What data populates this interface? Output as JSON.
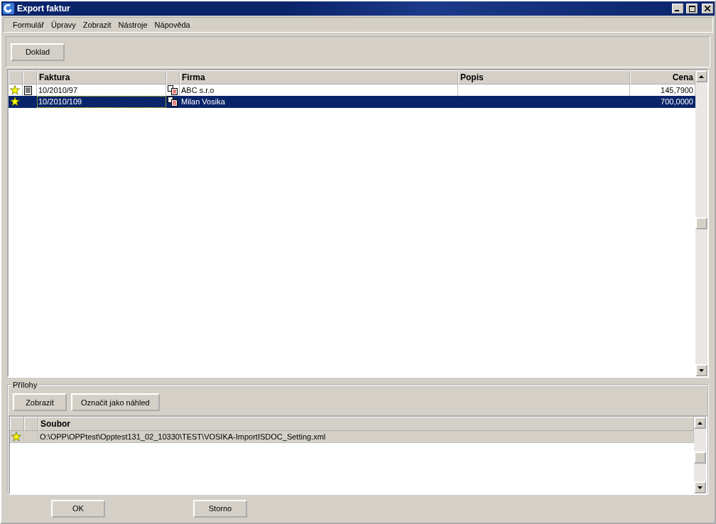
{
  "window": {
    "title": "Export faktur"
  },
  "menu": [
    "Formulář",
    "Úpravy",
    "Zobrazit",
    "Nástroje",
    "Nápověda"
  ],
  "toolbar": {
    "buttons": [
      "Doklad"
    ]
  },
  "invoices": {
    "columns": [
      "Faktura",
      "Firma",
      "Popis",
      "Cena"
    ],
    "rows": [
      {
        "faktura": "10/2010/97",
        "firma": "ABC s.r.o",
        "popis": "",
        "cena": "145,7900",
        "note": true,
        "selected": false
      },
      {
        "faktura": "10/2010/109",
        "firma": "Milan Vosika",
        "popis": "",
        "cena": "700,0000",
        "note": false,
        "selected": true
      }
    ]
  },
  "attachments": {
    "title": "Přílohy",
    "buttons": [
      "Zobrazit",
      "Označit jako náhled"
    ],
    "columns": [
      "Soubor"
    ],
    "rows": [
      {
        "soubor": "O:\\OPP\\OPPtest\\Opptest131_02_10330\\TEST\\VOSIKA-ImportISDOC_Setting.xml",
        "selected": true
      }
    ]
  },
  "footer": {
    "buttons": [
      "OK",
      "Storno"
    ]
  }
}
